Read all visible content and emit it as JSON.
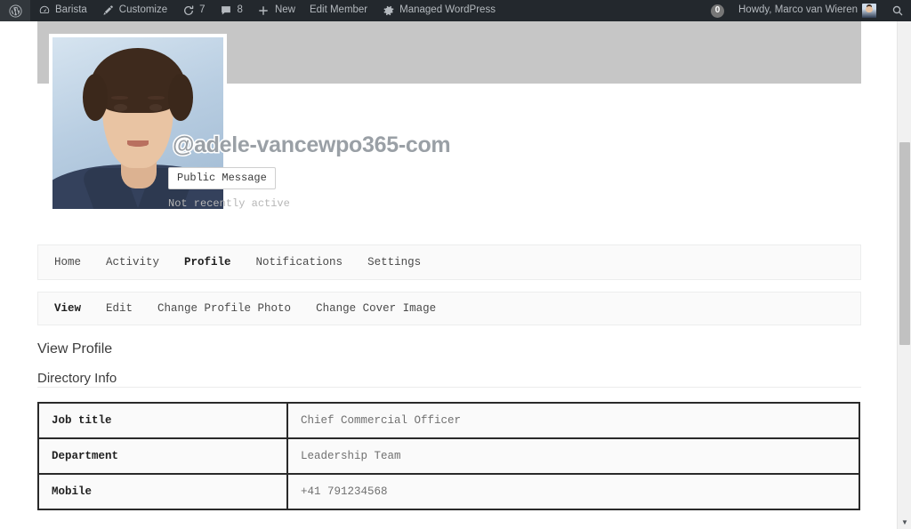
{
  "adminbar": {
    "left_items": [
      {
        "name": "wp-logo",
        "icon": "wordpress-icon",
        "label": ""
      },
      {
        "name": "site-name",
        "icon": "dashboard-icon",
        "label": "Barista"
      },
      {
        "name": "customize",
        "icon": "brush-icon",
        "label": "Customize"
      },
      {
        "name": "updates",
        "icon": "updates-icon",
        "label": "7"
      },
      {
        "name": "comments",
        "icon": "comment-icon",
        "label": "8"
      },
      {
        "name": "new-content",
        "icon": "plus-icon",
        "label": "New"
      },
      {
        "name": "edit-member",
        "icon": "",
        "label": "Edit Member"
      },
      {
        "name": "managed-wp",
        "icon": "gear-icon",
        "label": "Managed WordPress"
      }
    ],
    "notification_count": "0",
    "howdy": "Howdy, Marco van Wieren",
    "search_icon": "search-icon"
  },
  "profile": {
    "username": "@adele-vancewpo365-com",
    "public_message_label": "Public Message",
    "last_active": "Not recently active"
  },
  "primary_nav": [
    {
      "label": "Home",
      "active": false
    },
    {
      "label": "Activity",
      "active": false
    },
    {
      "label": "Profile",
      "active": true
    },
    {
      "label": "Notifications",
      "active": false
    },
    {
      "label": "Settings",
      "active": false
    }
  ],
  "secondary_nav": [
    {
      "label": "View",
      "active": true
    },
    {
      "label": "Edit",
      "active": false
    },
    {
      "label": "Change Profile Photo",
      "active": false
    },
    {
      "label": "Change Cover Image",
      "active": false
    }
  ],
  "main": {
    "view_profile_heading": "View Profile",
    "directory_info_heading": "Directory Info"
  },
  "directory_info": {
    "rows": [
      {
        "label": "Job title",
        "value": "Chief Commercial Officer"
      },
      {
        "label": "Department",
        "value": "Leadership Team"
      },
      {
        "label": "Mobile",
        "value": "+41 791234568"
      }
    ]
  },
  "scrollbar": {
    "up_arrow": "▲",
    "down_arrow": "▼"
  },
  "colors": {
    "adminbar_bg": "#23282d",
    "cover_bg": "#c6c6c6",
    "nav_bg": "#fafafa",
    "table_border": "#2a2a2a"
  }
}
